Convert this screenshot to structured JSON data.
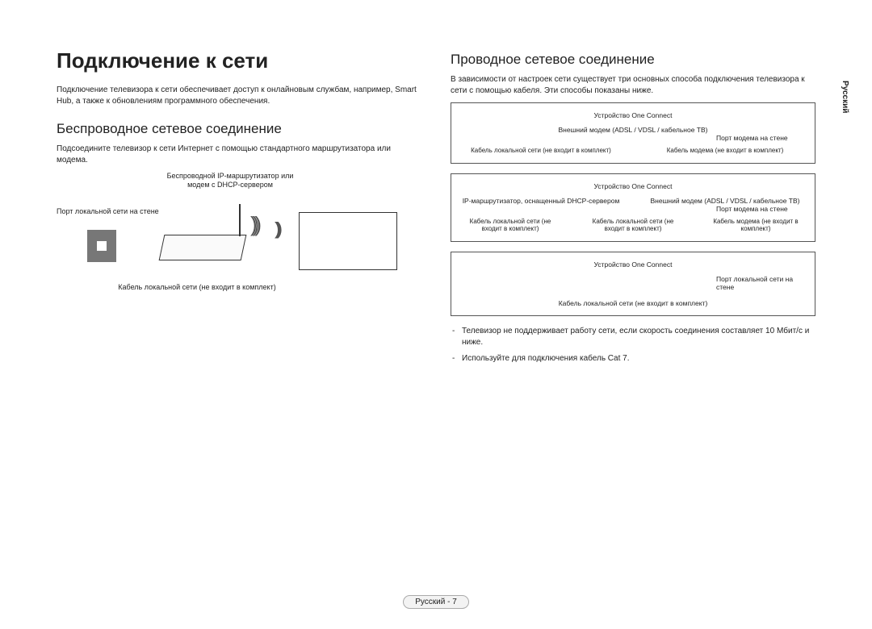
{
  "sidebar_lang": "Русский",
  "footer": "Русский - 7",
  "left": {
    "h1": "Подключение к сети",
    "intro": "Подключение телевизора к сети обеспечивает доступ к онлайновым службам, например, Smart Hub, а также к обновлениям программного обеспечения.",
    "h2": "Беспроводное сетевое соединение",
    "p2": "Подсоедините телевизор к сети Интернет с помощью стандартного маршрутизатора или модема.",
    "diagram": {
      "router_label": "Беспроводной IP-маршрутизатор\nили модем с DHCP-сервером",
      "wall_label": "Порт локальной сети на стене",
      "cable_label": "Кабель локальной сети (не входит в комплект)"
    }
  },
  "right": {
    "h2": "Проводное сетевое соединение",
    "intro": "В зависимости от настроек сети существует три основных способа подключения телевизора к сети с помощью кабеля. Эти способы показаны ниже.",
    "box1": {
      "device": "Устройство One Connect",
      "modem": "Внешний модем\n(ADSL / VDSL / кабельное ТВ)",
      "wallport": "Порт модема на стене",
      "lan": "Кабель локальной сети\n(не входит в комплект)",
      "mcable": "Кабель модема\n(не входит в комплект)"
    },
    "box2": {
      "device": "Устройство One Connect",
      "router": "IP-маршрутизатор,\nоснащенный DHCP-сервером",
      "modem": "Внешний модем\n(ADSL / VDSL / кабельное ТВ)",
      "wallport": "Порт модема\nна стене",
      "lan1": "Кабель локальной сети\n(не входит в комплект)",
      "lan2": "Кабель локальной сети\n(не входит в комплект)",
      "mcable": "Кабель модема\n(не входит в комплект)"
    },
    "box3": {
      "device": "Устройство One Connect",
      "wallport": "Порт локальной\nсети на стене",
      "lan": "Кабель локальной сети (не входит в комплект)"
    },
    "notes": [
      "Телевизор не поддерживает работу сети, если скорость соединения составляет 10 Мбит/с и ниже.",
      "Используйте для подключения кабель Cat 7."
    ]
  }
}
